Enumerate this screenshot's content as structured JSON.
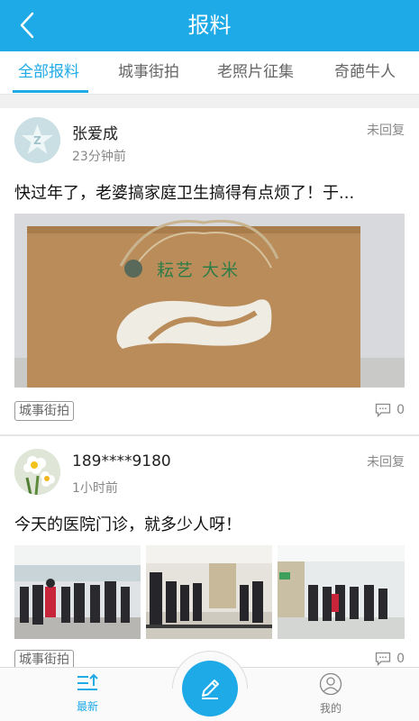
{
  "header": {
    "title": "报料"
  },
  "tabs": [
    {
      "label": "全部报料",
      "active": true
    },
    {
      "label": "城事街拍"
    },
    {
      "label": "老照片征集"
    },
    {
      "label": "奇葩牛人"
    }
  ],
  "posts": [
    {
      "username": "张爱成",
      "time": "23分钟前",
      "status": "未回复",
      "content": "快过年了，老婆搞家庭卫生搞得有点烦了！于...",
      "image_text": "耘艺 大米",
      "tag": "城事街拍",
      "comments": "0"
    },
    {
      "username": "189****9180",
      "time": "1小时前",
      "status": "未回复",
      "content": "今天的医院门诊，就多少人呀！",
      "tag": "城事街拍",
      "comments": "0"
    }
  ],
  "bottom_nav": {
    "latest_label": "最新",
    "mine_label": "我的"
  },
  "colors": {
    "accent": "#1ea9e7",
    "divider": "#e6e6e6"
  }
}
